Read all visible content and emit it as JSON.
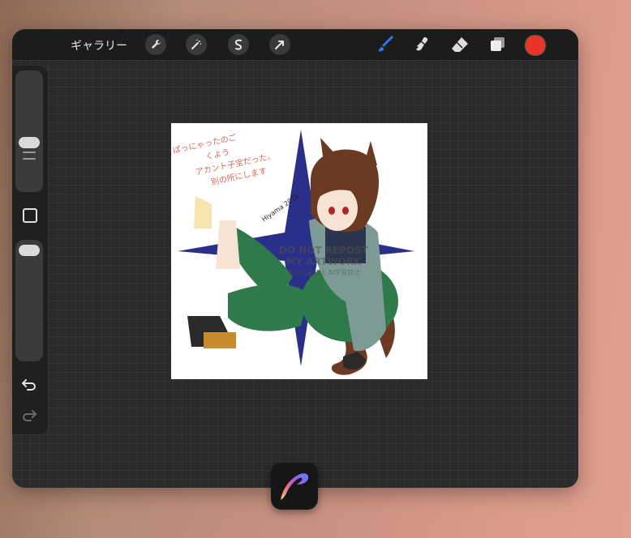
{
  "toolbar": {
    "gallery_label": "ギャラリー",
    "actions": [
      {
        "icon": "wrench-icon"
      },
      {
        "icon": "magic-wand-icon"
      },
      {
        "icon": "selection-icon"
      },
      {
        "icon": "transform-arrow-icon"
      }
    ],
    "tools": [
      {
        "icon": "brush-icon",
        "active": true
      },
      {
        "icon": "smudge-icon"
      },
      {
        "icon": "eraser-icon"
      },
      {
        "icon": "layers-icon"
      }
    ],
    "current_color": "#e8352b",
    "accent_color": "#2f7bf5"
  },
  "sidebar": {
    "size_slider": 0.55,
    "opacity_slider": 0.92,
    "undo_icon": "undo-icon",
    "redo_icon": "redo-icon"
  },
  "artwork": {
    "handwritten_note_lines": [
      "ぱっにゃったのご",
      "くよう",
      "アカント子宝だった。",
      "別の所にします"
    ],
    "watermark_lines": [
      "DO NOT REPOST",
      "MY ARTWORK",
      "無断転載禁止 AI学習禁止"
    ],
    "signature": "Hiyama 2018"
  },
  "dock": {
    "app_icon": "procreate-app-icon"
  }
}
